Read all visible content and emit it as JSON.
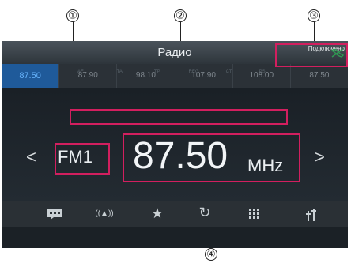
{
  "callouts": [
    "①",
    "②",
    "③",
    "④"
  ],
  "title": "Радио",
  "status": {
    "text": "Подключено",
    "icon": "phone-link-icon",
    "icon_color": "#2f9a52"
  },
  "presets": [
    "87.50",
    "87.90",
    "98.10",
    "107.90",
    "108.00",
    "87.50"
  ],
  "active_preset_index": 0,
  "flags": [
    "AF",
    "TA",
    "TP",
    "REG",
    "CT",
    "PS"
  ],
  "band": "FM1",
  "frequency": "87.50",
  "unit": "MHz",
  "nav": {
    "prev": "<",
    "next": ">"
  },
  "toolbar": {
    "message_icon": "message-icon",
    "antenna_icon": "antenna-icon",
    "star_icon": "star-icon",
    "refresh_icon": "refresh-icon",
    "grid_icon": "grid-icon",
    "settings_icon": "equalizer-icon"
  },
  "colors": {
    "highlight": "#d21f5f",
    "preset_active": "#1f5a9a"
  }
}
